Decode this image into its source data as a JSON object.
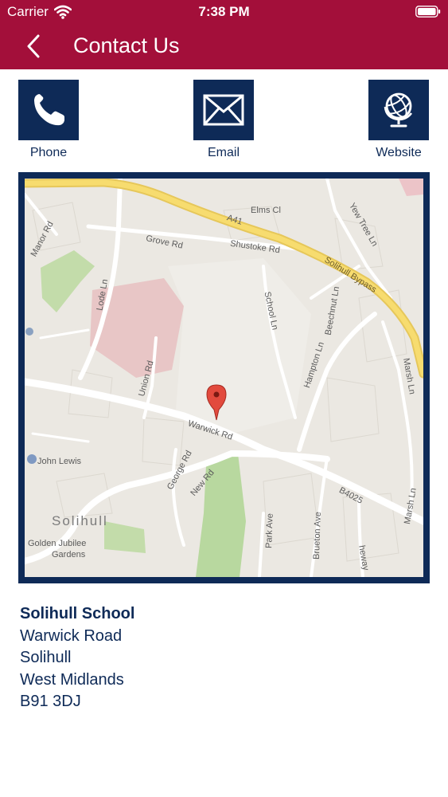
{
  "status_bar": {
    "carrier": "Carrier",
    "time": "7:38 PM"
  },
  "nav": {
    "title": "Contact Us"
  },
  "actions": [
    {
      "label": "Phone",
      "icon": "phone-icon"
    },
    {
      "label": "Email",
      "icon": "envelope-icon"
    },
    {
      "label": "Website",
      "icon": "globe-icon"
    }
  ],
  "map": {
    "labels": {
      "a41": "A41",
      "elms_cl": "Elms Cl",
      "yew_tree_ln": "Yew Tree Ln",
      "manor_rd": "Manor Rd",
      "grove_rd": "Grove Rd",
      "shustoke_rd": "Shustoke Rd",
      "solihull_bypass": "Solihull Bypass",
      "lode_ln": "Lode Ln",
      "school_ln": "School Ln",
      "beechnut_ln": "Beechnut Ln",
      "hampton_ln": "Hampton Ln",
      "union_rd": "Union Rd",
      "marsh_ln": "Marsh Ln",
      "warwick_rd": "Warwick Rd",
      "john_lewis": "John Lewis",
      "george_rd": "George Rd",
      "new_rd": "New Rd",
      "b4025": "B4025",
      "marsh_ln_2": "Marsh Ln",
      "solihull": "Solihull",
      "park_ave": "Park Ave",
      "brueton_ave": "Brueton Ave",
      "heway": "heway",
      "golden_jubilee": "Golden Jubilee",
      "gardens": "Gardens"
    }
  },
  "address": {
    "name": "Solihull School",
    "line1": "Warwick Road",
    "line2": "Solihull",
    "line3": "West Midlands",
    "line4": "B91 3DJ"
  },
  "colors": {
    "brand": "#a30f3a",
    "navy": "#0e2a57",
    "map_bg": "#ebe8e2"
  }
}
